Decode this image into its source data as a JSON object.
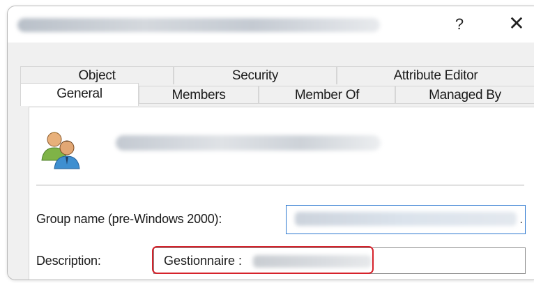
{
  "window": {
    "help_glyph": "?",
    "close_glyph": "✕"
  },
  "tabs": {
    "back_row": [
      "Object",
      "Security",
      "Attribute Editor"
    ],
    "front_row": [
      "General",
      "Members",
      "Member Of",
      "Managed By"
    ],
    "selected": "General"
  },
  "general": {
    "icon": "users-group-icon",
    "pre2000_label": "Group name (pre-Windows 2000):",
    "description_label": "Description:",
    "description_value": "Gestionnaire :",
    "pre2000_suffix": "."
  },
  "colors": {
    "highlight": "#d6222b",
    "focus_border": "#2c78d0"
  }
}
